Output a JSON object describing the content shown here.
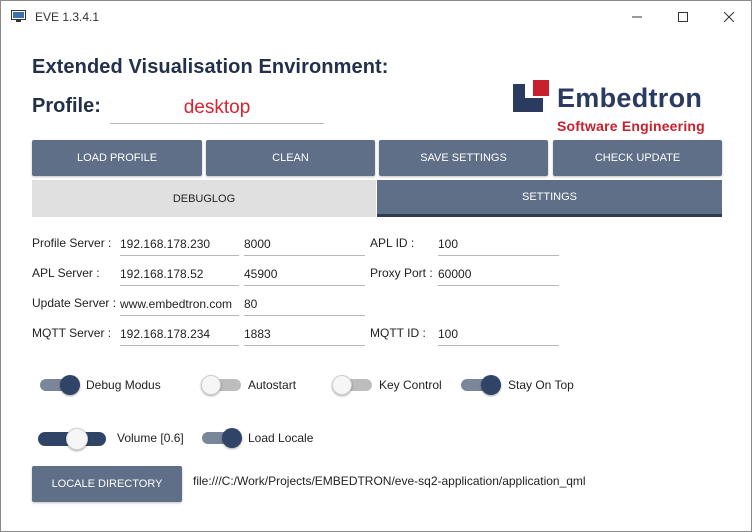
{
  "window": {
    "title": "EVE 1.3.4.1"
  },
  "header": {
    "heading": "Extended Visualisation Environment:",
    "profile_label": "Profile:",
    "profile_value": "desktop"
  },
  "logo": {
    "name": "Embedtron",
    "subtitle": "Software Engineering"
  },
  "toolbar": {
    "load_profile": "LOAD PROFILE",
    "clean": "CLEAN",
    "save_settings": "SAVE SETTINGS",
    "check_update": "CHECK UPDATE"
  },
  "tabs": {
    "debuglog": "DEBUGLOG",
    "settings": "SETTINGS",
    "active": "settings"
  },
  "settings": {
    "profile_server": {
      "label": "Profile Server :",
      "host": "192.168.178.230",
      "port": "8000"
    },
    "apl_server": {
      "label": "APL Server :",
      "host": "192.168.178.52",
      "port": "45900"
    },
    "update_server": {
      "label": "Update Server :",
      "host": "www.embedtron.com",
      "port": "80"
    },
    "mqtt_server": {
      "label": "MQTT Server :",
      "host": "192.168.178.234",
      "port": "1883"
    },
    "apl_id": {
      "label": "APL ID :",
      "value": "100"
    },
    "proxy_port": {
      "label": "Proxy Port :",
      "value": "60000"
    },
    "mqtt_id": {
      "label": "MQTT ID :",
      "value": "100"
    }
  },
  "toggles": {
    "debug_modus": {
      "label": "Debug Modus",
      "on": true
    },
    "autostart": {
      "label": "Autostart",
      "on": false
    },
    "key_control": {
      "label": "Key Control",
      "on": false
    },
    "stay_on_top": {
      "label": "Stay On Top",
      "on": true
    },
    "load_locale": {
      "label": "Load Locale",
      "on": true
    }
  },
  "volume": {
    "label": "Volume [0.6]",
    "value": 0.6
  },
  "locale": {
    "button": "LOCALE DIRECTORY",
    "path": "file:///C:/Work/Projects/EMBEDTRON/eve-sq2-application/application_qml"
  },
  "colors": {
    "accent": "#5f6f87",
    "dark": "#2f4466",
    "brand_red": "#c8202c",
    "profile_red": "#d9232f"
  }
}
